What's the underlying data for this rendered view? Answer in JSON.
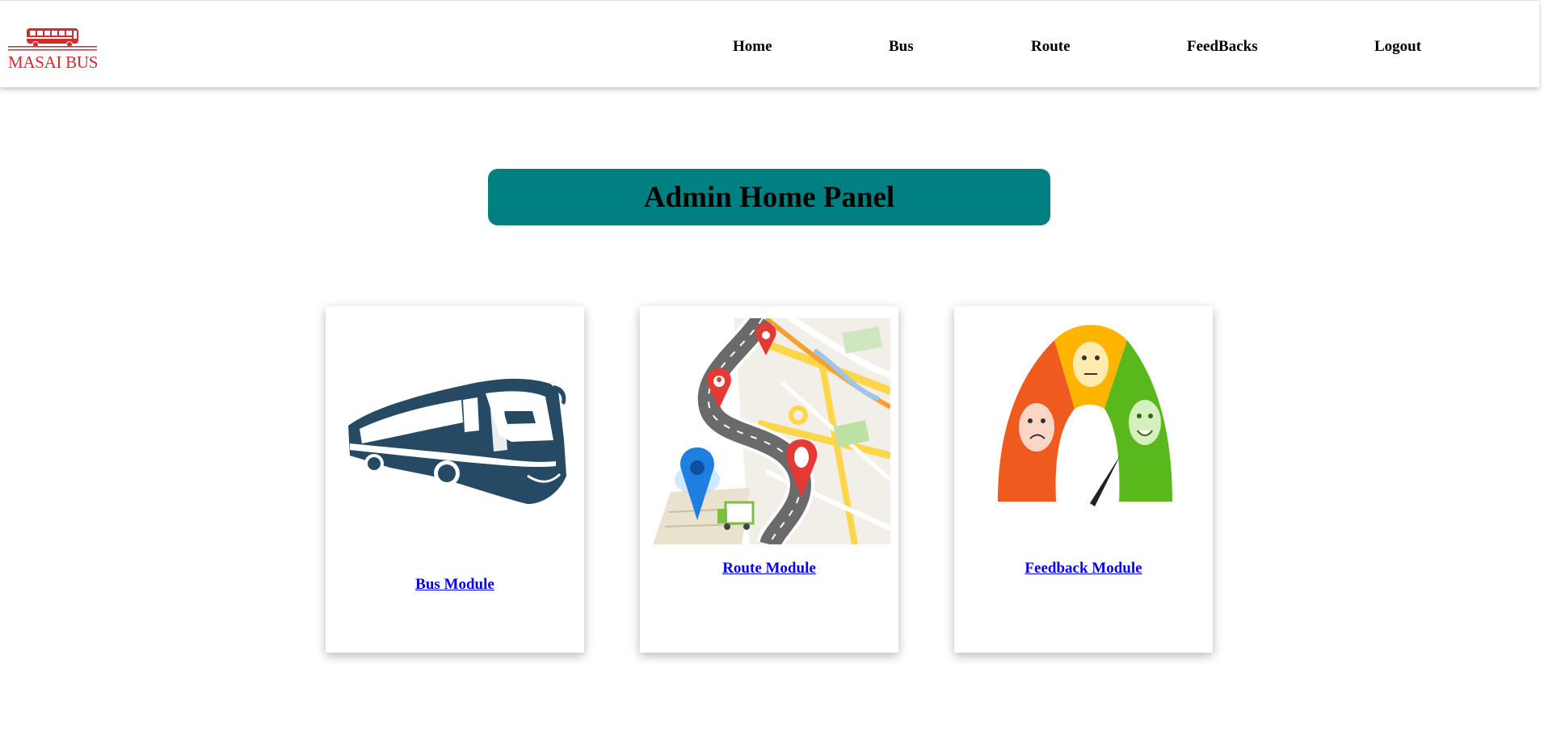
{
  "brand": {
    "name": "MASAI BUS",
    "color": "#d42b2b"
  },
  "nav": {
    "home": "Home",
    "bus": "Bus",
    "route": "Route",
    "feedbacks": "FeedBacks",
    "logout": "Logout"
  },
  "panel": {
    "title": "Admin Home Panel",
    "background": "#008080"
  },
  "cards": {
    "bus": {
      "label": "Bus Module",
      "icon": "bus-illustration"
    },
    "route": {
      "label": "Route Module",
      "icon": "route-map-illustration"
    },
    "feedback": {
      "label": "Feedback Module",
      "icon": "feedback-meter-illustration"
    }
  },
  "colors": {
    "link": "#0000ee",
    "bus_icon": "#264a63"
  }
}
